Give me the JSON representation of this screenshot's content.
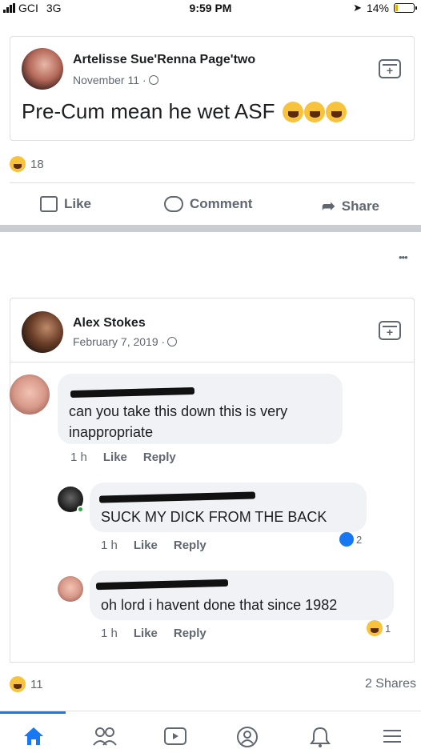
{
  "status": {
    "carrier": "GCI",
    "network": "3G",
    "time": "9:59 PM",
    "battery": "14%"
  },
  "post1": {
    "author": "Artelisse Sue'Renna Page'two",
    "date": "November 11 ·",
    "text": "Pre-Cum mean he wet ASF",
    "reactions_count": "18",
    "actions": {
      "like": "Like",
      "comment": "Comment",
      "share": "Share"
    }
  },
  "post2": {
    "menu": "•••",
    "author": "Alex Stokes",
    "date": "February 7, 2019 ·",
    "comments": [
      {
        "text": "can you take this down this is very inappropriate",
        "time": "1 h",
        "like": "Like",
        "reply": "Reply"
      },
      {
        "text": "SUCK MY DICK FROM THE BACK",
        "time": "1 h",
        "like": "Like",
        "reply": "Reply",
        "reaction_count": "2"
      },
      {
        "text": "oh lord i havent done that since 1982",
        "time": "1 h",
        "like": "Like",
        "reply": "Reply",
        "reaction_count": "1"
      }
    ],
    "reactions_count": "11",
    "shares": "2 Shares"
  },
  "colors": {
    "brand": "#1877f2",
    "muted": "#606770",
    "bubble": "#f0f2f5"
  },
  "nav_icons": [
    "home-icon",
    "friends-icon",
    "watch-icon",
    "profile-icon",
    "notifications-icon",
    "menu-icon"
  ]
}
